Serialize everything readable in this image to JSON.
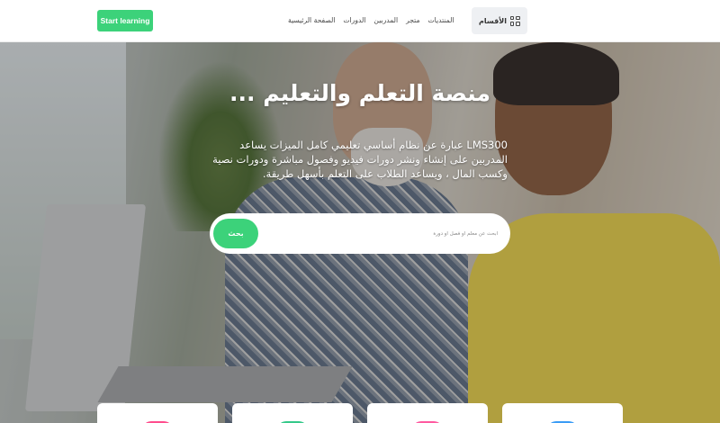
{
  "header": {
    "start_button": "Start learning",
    "nav_items": [
      "الصفحة الرئيسية",
      "الدورات",
      "المدربين",
      "متجر",
      "المنتديات"
    ],
    "categories_label": "الأقسام"
  },
  "hero": {
    "title": "منصة التعلم والتعليم ...",
    "description": "LMS300 عبارة عن نظام أساسي تعليمي كامل الميزات يساعد المدربين على إنشاء ونشر دورات فيديو وفصول مباشرة ودورات نصية وكسب المال ، ويساعد الطلاب على التعلم بأسهل طريقة.",
    "search_placeholder": "ابحث عن معلم أو فصل أو دورة",
    "search_button": "بحث"
  },
  "colors": {
    "accent": "#3cd27a",
    "card_chips": [
      "#ff4d8d",
      "#35c98a",
      "#ff5aa0",
      "#3b9cf5"
    ]
  },
  "icons": {
    "categories": "grid-icon"
  }
}
